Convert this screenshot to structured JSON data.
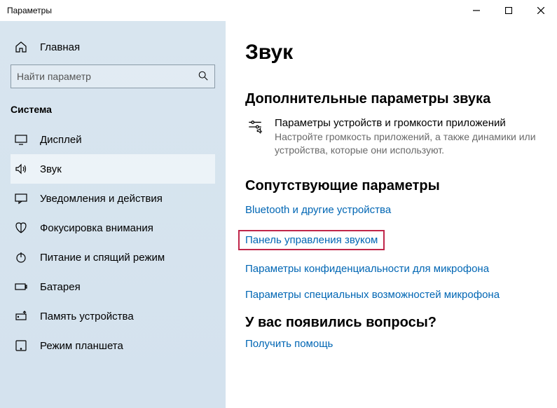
{
  "window": {
    "title": "Параметры"
  },
  "sidebar": {
    "home": "Главная",
    "search_placeholder": "Найти параметр",
    "category": "Система",
    "items": [
      {
        "label": "Дисплей"
      },
      {
        "label": "Звук"
      },
      {
        "label": "Уведомления и действия"
      },
      {
        "label": "Фокусировка внимания"
      },
      {
        "label": "Питание и спящий режим"
      },
      {
        "label": "Батарея"
      },
      {
        "label": "Память устройства"
      },
      {
        "label": "Режим планшета"
      }
    ]
  },
  "main": {
    "title": "Звук",
    "section1": {
      "heading": "Дополнительные параметры звука",
      "item_title": "Параметры устройств и громкости приложений",
      "item_desc": "Настройте громкость приложений, а также динамики или устройства, которые они используют."
    },
    "section2": {
      "heading": "Сопутствующие параметры",
      "link_bluetooth": "Bluetooth и другие устройства",
      "link_sound_panel": "Панель управления звуком",
      "link_mic_privacy": "Параметры конфиденциальности для микрофона",
      "link_mic_ease": "Параметры специальных возможностей микрофона"
    },
    "questions": {
      "heading": "У вас появились вопросы?",
      "link": "Получить помощь"
    }
  }
}
